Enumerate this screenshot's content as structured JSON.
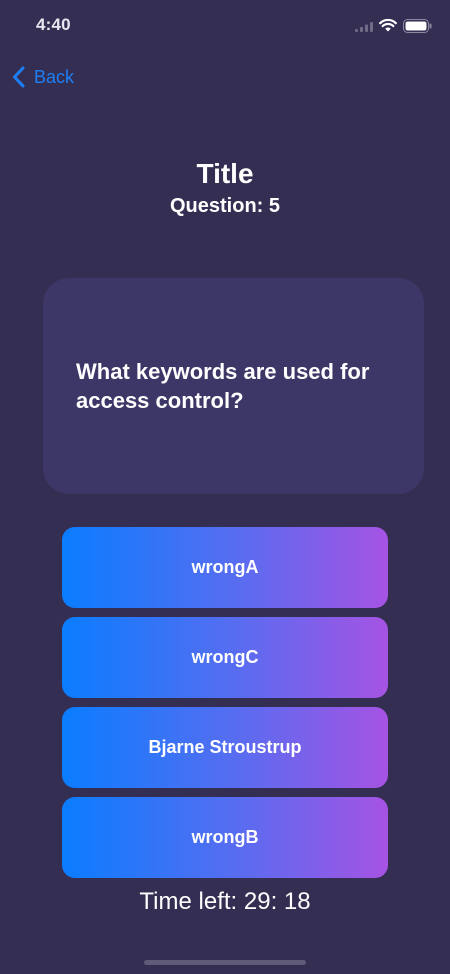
{
  "status_bar": {
    "time": "4:40",
    "icons": [
      "signal-icon",
      "wifi-icon",
      "battery-icon"
    ]
  },
  "nav": {
    "back_label": "Back",
    "back_icon": "chevron-left-icon"
  },
  "header": {
    "title": "Title",
    "question_counter": "Question: 5"
  },
  "question": {
    "text": "What keywords are used for access control?"
  },
  "answers": [
    {
      "label": "wrongA"
    },
    {
      "label": "wrongC"
    },
    {
      "label": "Bjarne Stroustrup"
    },
    {
      "label": "wrongB"
    }
  ],
  "timer": {
    "text": "Time left: 29: 18"
  },
  "colors": {
    "background": "#352e53",
    "card": "#3d3768",
    "accent": "#1d7ff6",
    "gradient_start": "#0a7dfe",
    "gradient_end": "#a653e3"
  }
}
